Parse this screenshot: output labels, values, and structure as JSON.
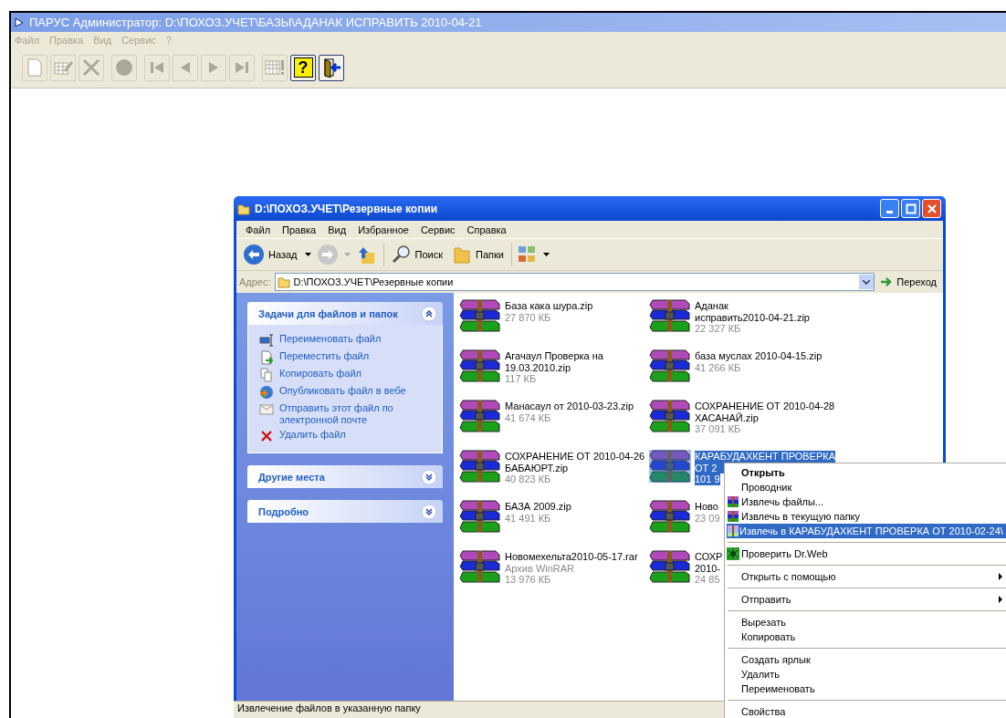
{
  "app": {
    "title": "ПАРУС Администратор: D:\\ПОХОЗ.УЧЕТ\\БАЗЫ\\АДАНАК ИСПРАВИТЬ 2010-04-21",
    "menu": [
      {
        "label": "Файл",
        "disabled": true
      },
      {
        "label": "Правка",
        "disabled": true
      },
      {
        "label": "Вид",
        "disabled": true
      },
      {
        "label": "Сервис",
        "disabled": true
      },
      {
        "label": "?",
        "disabled": true
      }
    ],
    "toolbar": [
      [
        {
          "disabled": true
        },
        {
          "disabled": true
        },
        {
          "disabled": true
        }
      ],
      [
        {
          "disabled": true
        }
      ],
      [
        {
          "disabled": true
        },
        {
          "disabled": true
        },
        {
          "disabled": true
        },
        {
          "disabled": true
        }
      ],
      [
        {
          "disabled": true
        },
        {
          "disabled": false,
          "glyph": "?"
        },
        {
          "disabled": false
        }
      ]
    ]
  },
  "explorer": {
    "title": "D:\\ПОХОЗ.УЧЕТ\\Резервные копии",
    "menu": [
      "Файл",
      "Правка",
      "Вид",
      "Избранное",
      "Сервис",
      "Справка"
    ],
    "toolbar": {
      "back": "Назад",
      "search": "Поиск",
      "folders": "Папки"
    },
    "address": {
      "label": "Адрес:",
      "value": "D:\\ПОХОЗ.УЧЕТ\\Резервные копии",
      "go": "Переход"
    },
    "panels": [
      {
        "title": "Задачи для файлов и папок",
        "expanded": true,
        "items": [
          "Переименовать файл",
          "Переместить файл",
          "Копировать файл",
          "Опубликовать файл в вебе",
          "Отправить этот файл по электронной почте",
          "Удалить файл"
        ]
      },
      {
        "title": "Другие места",
        "expanded": false
      },
      {
        "title": "Подробно",
        "expanded": false
      }
    ],
    "files": [
      {
        "name": [
          "База кака шура.zip"
        ],
        "size": "27 870 КБ",
        "selected": false
      },
      {
        "name": [
          "Аданак",
          "исправить2010-04-21.zip"
        ],
        "size": "22 327 КБ",
        "selected": false
      },
      {
        "name": [
          "Агачаул Проверка на",
          "19.03.2010.zip"
        ],
        "size": "117 КБ",
        "selected": false
      },
      {
        "name": [
          "база муслах 2010-04-15.zip"
        ],
        "size": "41 266 КБ",
        "selected": false
      },
      {
        "name": [
          "Манасаул от 2010-03-23.zip"
        ],
        "size": "41 674 КБ",
        "selected": false
      },
      {
        "name": [
          "СОХРАНЕНИЕ ОТ 2010-04-28",
          "ХАСАНАЙ.zip"
        ],
        "size": "37 091 КБ",
        "selected": false
      },
      {
        "name": [
          "СОХРАНЕНИЕ ОТ 2010-04-26",
          "БАБАЮРТ.zip"
        ],
        "size": "40 823 КБ",
        "selected": false
      },
      {
        "name": [
          "КАРАБУДАХКЕНТ ПРОВЕРКА",
          "ОТ 2"
        ],
        "size": "101 9",
        "selected": true
      },
      {
        "name": [
          "БАЗА 2009.zip"
        ],
        "size": "41 491 КБ",
        "selected": false
      },
      {
        "name": [
          "Ново"
        ],
        "size": "23 09",
        "selected": false
      },
      {
        "name": [
          "Новомехельта2010-05-17.rar"
        ],
        "type": "Архив WinRAR",
        "size": "13 976 КБ",
        "selected": false
      },
      {
        "name": [
          "СОХР",
          "2010-"
        ],
        "size": "24 85",
        "selected": false
      }
    ],
    "status": "Извлечение файлов в указанную папку"
  },
  "context_menu": [
    {
      "kind": "plain",
      "label": "Открыть",
      "default": true,
      "selected": false,
      "submenu": false
    },
    {
      "kind": "plain",
      "label": "Проводник",
      "default": false,
      "selected": false,
      "submenu": false
    },
    {
      "kind": "archiver",
      "label": "Извлечь файлы...",
      "default": false,
      "selected": false,
      "submenu": false
    },
    {
      "kind": "archiver",
      "label": "Извлечь в текущую папку",
      "default": false,
      "selected": false,
      "submenu": false
    },
    {
      "kind": "archiver",
      "label": "Извлечь в КАРАБУДАХКЕНТ ПРОВЕРКА ОТ 2010-02-24\\",
      "default": false,
      "selected": true,
      "submenu": false
    },
    {
      "kind": "separator"
    },
    {
      "kind": "antivirus",
      "label": "Проверить Dr.Web",
      "default": false,
      "selected": false,
      "submenu": false
    },
    {
      "kind": "separator"
    },
    {
      "kind": "plain",
      "label": "Открыть с помощью",
      "default": false,
      "selected": false,
      "submenu": true
    },
    {
      "kind": "separator"
    },
    {
      "kind": "plain",
      "label": "Отправить",
      "default": false,
      "selected": false,
      "submenu": true
    },
    {
      "kind": "separator"
    },
    {
      "kind": "plain",
      "label": "Вырезать",
      "default": false,
      "selected": false,
      "submenu": false
    },
    {
      "kind": "plain",
      "label": "Копировать",
      "default": false,
      "selected": false,
      "submenu": false
    },
    {
      "kind": "separator"
    },
    {
      "kind": "plain",
      "label": "Создать ярлык",
      "default": false,
      "selected": false,
      "submenu": false
    },
    {
      "kind": "plain",
      "label": "Удалить",
      "default": false,
      "selected": false,
      "submenu": false
    },
    {
      "kind": "plain",
      "label": "Переименовать",
      "default": false,
      "selected": false,
      "submenu": false
    },
    {
      "kind": "separator"
    },
    {
      "kind": "plain",
      "label": "Свойства",
      "default": false,
      "selected": false,
      "submenu": false
    }
  ]
}
